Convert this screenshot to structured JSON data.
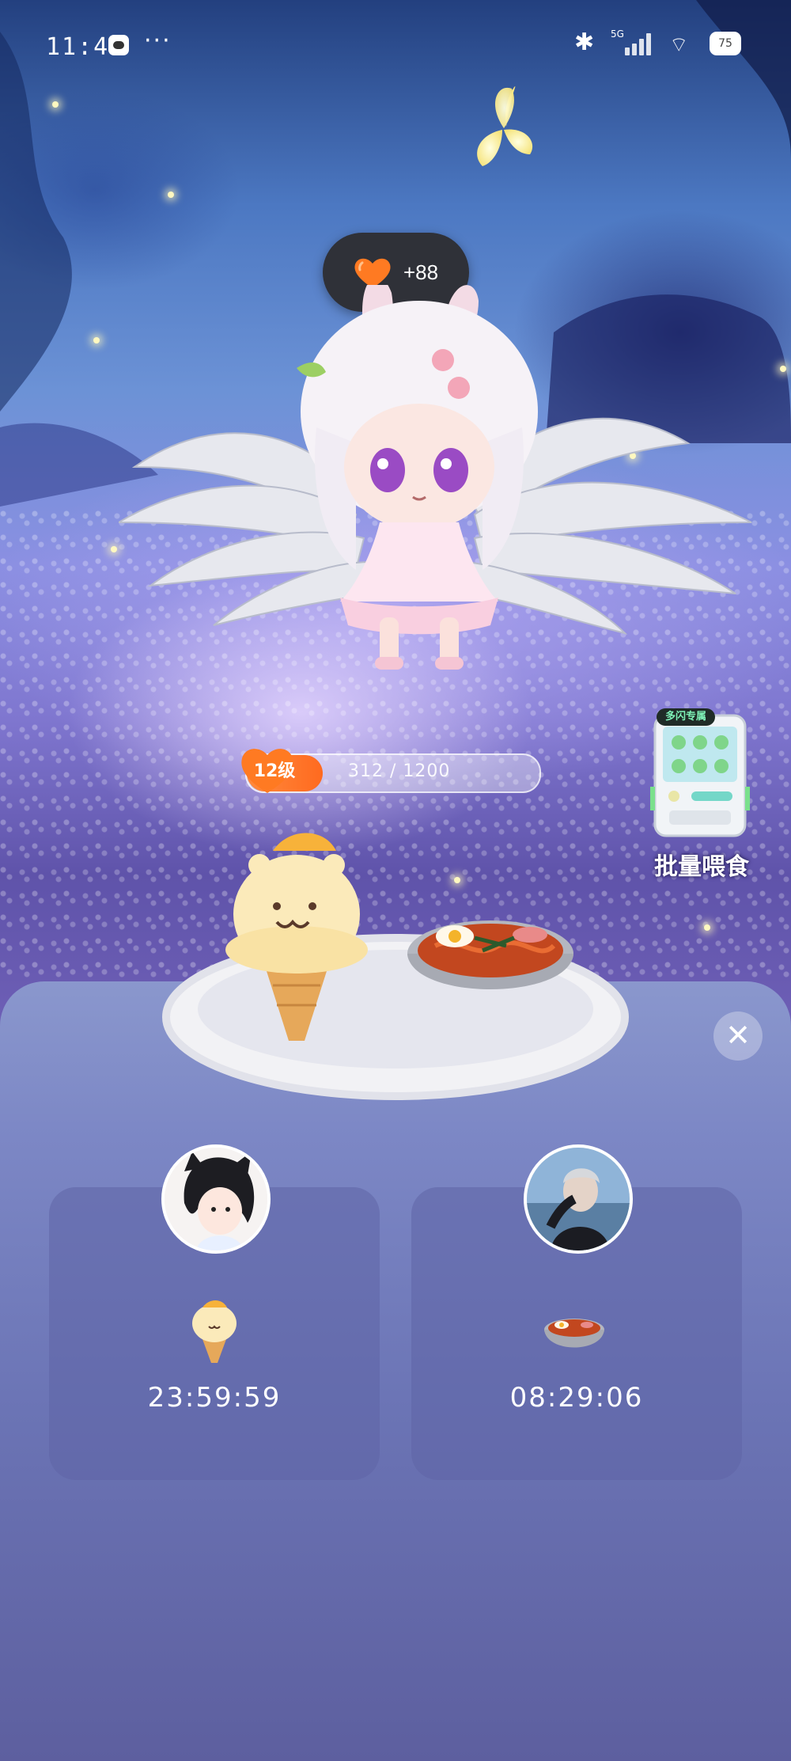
{
  "status_bar": {
    "time": "11:41",
    "network": "5G",
    "battery": "75"
  },
  "reward": {
    "value": "+88"
  },
  "level": {
    "label": "12级",
    "progress_text": "312 / 1200",
    "current": 312,
    "max": 1200
  },
  "batch_feed": {
    "badge": "多闪专属",
    "label": "批量喂食"
  },
  "feeders": [
    {
      "food": "ice-cream",
      "timer": "23:59:59"
    },
    {
      "food": "noodle-bowl",
      "timer": "08:29:06"
    }
  ],
  "colors": {
    "level_fill": "#ff7a2a",
    "panel": "#6b74b5",
    "bubble": "#2f3138"
  }
}
